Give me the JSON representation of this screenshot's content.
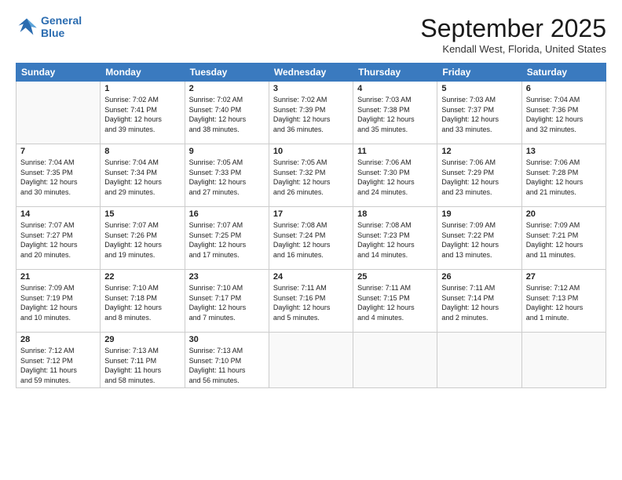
{
  "logo": {
    "line1": "General",
    "line2": "Blue"
  },
  "title": "September 2025",
  "location": "Kendall West, Florida, United States",
  "weekdays": [
    "Sunday",
    "Monday",
    "Tuesday",
    "Wednesday",
    "Thursday",
    "Friday",
    "Saturday"
  ],
  "weeks": [
    [
      {
        "day": "",
        "info": ""
      },
      {
        "day": "1",
        "info": "Sunrise: 7:02 AM\nSunset: 7:41 PM\nDaylight: 12 hours\nand 39 minutes."
      },
      {
        "day": "2",
        "info": "Sunrise: 7:02 AM\nSunset: 7:40 PM\nDaylight: 12 hours\nand 38 minutes."
      },
      {
        "day": "3",
        "info": "Sunrise: 7:02 AM\nSunset: 7:39 PM\nDaylight: 12 hours\nand 36 minutes."
      },
      {
        "day": "4",
        "info": "Sunrise: 7:03 AM\nSunset: 7:38 PM\nDaylight: 12 hours\nand 35 minutes."
      },
      {
        "day": "5",
        "info": "Sunrise: 7:03 AM\nSunset: 7:37 PM\nDaylight: 12 hours\nand 33 minutes."
      },
      {
        "day": "6",
        "info": "Sunrise: 7:04 AM\nSunset: 7:36 PM\nDaylight: 12 hours\nand 32 minutes."
      }
    ],
    [
      {
        "day": "7",
        "info": "Sunrise: 7:04 AM\nSunset: 7:35 PM\nDaylight: 12 hours\nand 30 minutes."
      },
      {
        "day": "8",
        "info": "Sunrise: 7:04 AM\nSunset: 7:34 PM\nDaylight: 12 hours\nand 29 minutes."
      },
      {
        "day": "9",
        "info": "Sunrise: 7:05 AM\nSunset: 7:33 PM\nDaylight: 12 hours\nand 27 minutes."
      },
      {
        "day": "10",
        "info": "Sunrise: 7:05 AM\nSunset: 7:32 PM\nDaylight: 12 hours\nand 26 minutes."
      },
      {
        "day": "11",
        "info": "Sunrise: 7:06 AM\nSunset: 7:30 PM\nDaylight: 12 hours\nand 24 minutes."
      },
      {
        "day": "12",
        "info": "Sunrise: 7:06 AM\nSunset: 7:29 PM\nDaylight: 12 hours\nand 23 minutes."
      },
      {
        "day": "13",
        "info": "Sunrise: 7:06 AM\nSunset: 7:28 PM\nDaylight: 12 hours\nand 21 minutes."
      }
    ],
    [
      {
        "day": "14",
        "info": "Sunrise: 7:07 AM\nSunset: 7:27 PM\nDaylight: 12 hours\nand 20 minutes."
      },
      {
        "day": "15",
        "info": "Sunrise: 7:07 AM\nSunset: 7:26 PM\nDaylight: 12 hours\nand 19 minutes."
      },
      {
        "day": "16",
        "info": "Sunrise: 7:07 AM\nSunset: 7:25 PM\nDaylight: 12 hours\nand 17 minutes."
      },
      {
        "day": "17",
        "info": "Sunrise: 7:08 AM\nSunset: 7:24 PM\nDaylight: 12 hours\nand 16 minutes."
      },
      {
        "day": "18",
        "info": "Sunrise: 7:08 AM\nSunset: 7:23 PM\nDaylight: 12 hours\nand 14 minutes."
      },
      {
        "day": "19",
        "info": "Sunrise: 7:09 AM\nSunset: 7:22 PM\nDaylight: 12 hours\nand 13 minutes."
      },
      {
        "day": "20",
        "info": "Sunrise: 7:09 AM\nSunset: 7:21 PM\nDaylight: 12 hours\nand 11 minutes."
      }
    ],
    [
      {
        "day": "21",
        "info": "Sunrise: 7:09 AM\nSunset: 7:19 PM\nDaylight: 12 hours\nand 10 minutes."
      },
      {
        "day": "22",
        "info": "Sunrise: 7:10 AM\nSunset: 7:18 PM\nDaylight: 12 hours\nand 8 minutes."
      },
      {
        "day": "23",
        "info": "Sunrise: 7:10 AM\nSunset: 7:17 PM\nDaylight: 12 hours\nand 7 minutes."
      },
      {
        "day": "24",
        "info": "Sunrise: 7:11 AM\nSunset: 7:16 PM\nDaylight: 12 hours\nand 5 minutes."
      },
      {
        "day": "25",
        "info": "Sunrise: 7:11 AM\nSunset: 7:15 PM\nDaylight: 12 hours\nand 4 minutes."
      },
      {
        "day": "26",
        "info": "Sunrise: 7:11 AM\nSunset: 7:14 PM\nDaylight: 12 hours\nand 2 minutes."
      },
      {
        "day": "27",
        "info": "Sunrise: 7:12 AM\nSunset: 7:13 PM\nDaylight: 12 hours\nand 1 minute."
      }
    ],
    [
      {
        "day": "28",
        "info": "Sunrise: 7:12 AM\nSunset: 7:12 PM\nDaylight: 11 hours\nand 59 minutes."
      },
      {
        "day": "29",
        "info": "Sunrise: 7:13 AM\nSunset: 7:11 PM\nDaylight: 11 hours\nand 58 minutes."
      },
      {
        "day": "30",
        "info": "Sunrise: 7:13 AM\nSunset: 7:10 PM\nDaylight: 11 hours\nand 56 minutes."
      },
      {
        "day": "",
        "info": ""
      },
      {
        "day": "",
        "info": ""
      },
      {
        "day": "",
        "info": ""
      },
      {
        "day": "",
        "info": ""
      }
    ]
  ]
}
